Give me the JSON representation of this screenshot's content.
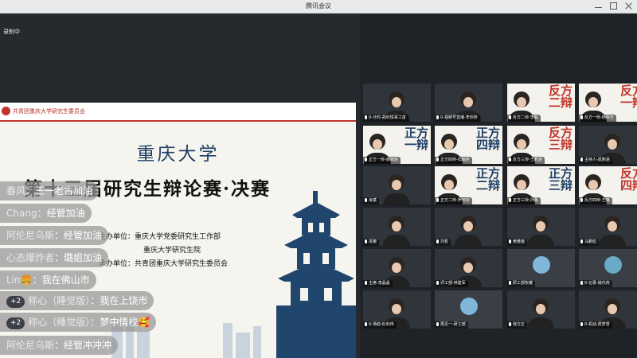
{
  "window": {
    "title": "腾讯会议"
  },
  "status": {
    "recording": "录制中"
  },
  "slide": {
    "org": "共青团重庆大学研究生委员会",
    "university": "重庆大学",
    "contest": "第十三届研究生辩论赛·决赛",
    "sponsors": [
      "主办单位：重庆大学党委研究生工作部",
      "重庆大学研究生院",
      "承办单位：共青团重庆大学研究生委员会"
    ],
    "colors": {
      "accent": "#c0342b",
      "blue": "#1e3f66"
    }
  },
  "chat": [
    {
      "name": "春风",
      "message": "王一老古加油"
    },
    {
      "name": "Chang",
      "message": "经管加油"
    },
    {
      "name": "阿伦尼乌斯",
      "message": "经管加油"
    },
    {
      "name": "心态爆炸者",
      "message": "璐姐加油"
    },
    {
      "name": "Lin🍔",
      "message": "我在佛山市"
    },
    {
      "badge": "+2",
      "name": "称心（睡觉版）",
      "message": "我在上饶市"
    },
    {
      "badge": "+2",
      "name": "称心（睡觉版）",
      "message": "梦中情校🥰"
    },
    {
      "name": "阿伦尼乌斯",
      "message": "经管冲冲冲"
    }
  ],
  "participants": [
    {
      "name": "0-计时-胡欣悦事工苗",
      "type": "video"
    },
    {
      "name": "0-视频号直播-李欣桥",
      "type": "video"
    },
    {
      "name": "反方二辩-李毅",
      "type": "debater",
      "debater": "反方二辩",
      "side": "red"
    },
    {
      "name": "反方一辩-杨倩天",
      "type": "debater",
      "debater": "反方一辩",
      "side": "red"
    },
    {
      "name": "正方一辩-谢晓玥",
      "type": "debater",
      "debater": "正方一辩",
      "side": "blue"
    },
    {
      "name": "正方四辩-石翰尧",
      "type": "debater",
      "debater": "正方四辩",
      "side": "blue"
    },
    {
      "name": "反方三辩-王若涵",
      "type": "debater",
      "debater": "反方三辩",
      "side": "red"
    },
    {
      "name": "主持人-成丽涵",
      "type": "video"
    },
    {
      "name": "肖斌",
      "type": "video"
    },
    {
      "name": "正方二辩-罗可欣",
      "type": "debater",
      "debater": "正方二辩",
      "side": "blue"
    },
    {
      "name": "正方三辩-孙菁",
      "type": "debater",
      "debater": "正方三辩",
      "side": "blue"
    },
    {
      "name": "反方四辩-王琳",
      "type": "debater",
      "debater": "反方四辩",
      "side": "red"
    },
    {
      "name": "贾娜",
      "type": "video"
    },
    {
      "name": "刘哲",
      "type": "video"
    },
    {
      "name": "黄雅茜",
      "type": "video"
    },
    {
      "name": "马鹏彪",
      "type": "video"
    },
    {
      "name": "主席-李晶晶",
      "type": "video"
    },
    {
      "name": "评工部-林建军",
      "type": "video"
    },
    {
      "name": "研工部张耀",
      "type": "avatar"
    },
    {
      "name": "0-记录-姚代芮",
      "type": "avatar"
    },
    {
      "name": "0-场助-杜利伟",
      "type": "video"
    },
    {
      "name": "再见一-研工部",
      "type": "avatar"
    },
    {
      "name": "徐方正",
      "type": "video"
    },
    {
      "name": "0-机动-费梦雪",
      "type": "video"
    }
  ]
}
